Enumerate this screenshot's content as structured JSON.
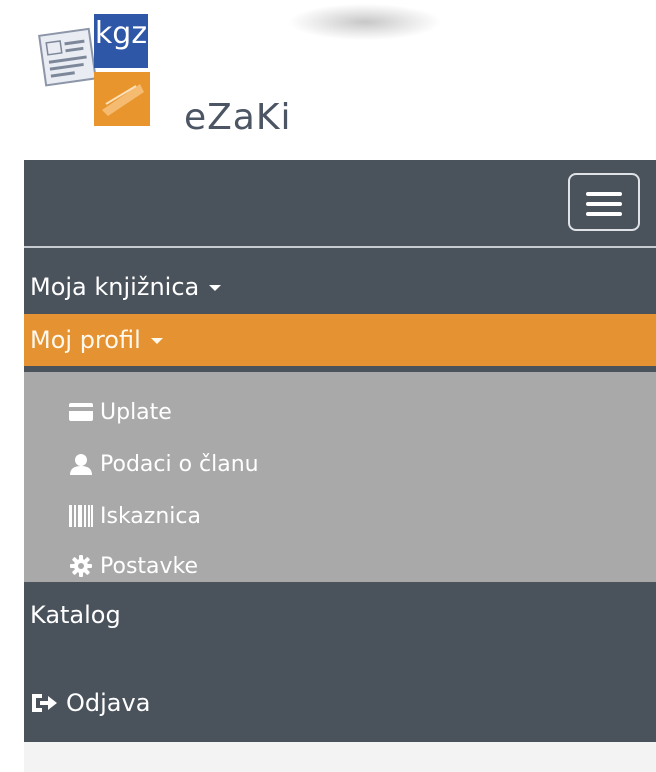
{
  "brand": {
    "logo_mark_text": "kgz",
    "app_name": "eZaKi",
    "colors": {
      "blue": "#2e57a8",
      "orange": "#e8952e"
    }
  },
  "navbar": {
    "toggle_icon": "hamburger-icon",
    "background": "#4a525c",
    "items": [
      {
        "label": "Moja knjižnica",
        "has_dropdown": true
      },
      {
        "label": "Moj profil",
        "has_dropdown": true,
        "active": true,
        "accent": "#e59232"
      },
      {
        "label": "Katalog"
      },
      {
        "label": "Odjava",
        "icon": "logout-icon"
      }
    ],
    "submenu": [
      {
        "label": "Uplate",
        "icon": "credit-card-icon"
      },
      {
        "label": "Podaci o članu",
        "icon": "user-icon"
      },
      {
        "label": "Iskaznica",
        "icon": "barcode-icon"
      },
      {
        "label": "Postavke",
        "icon": "gear-icon"
      }
    ]
  }
}
